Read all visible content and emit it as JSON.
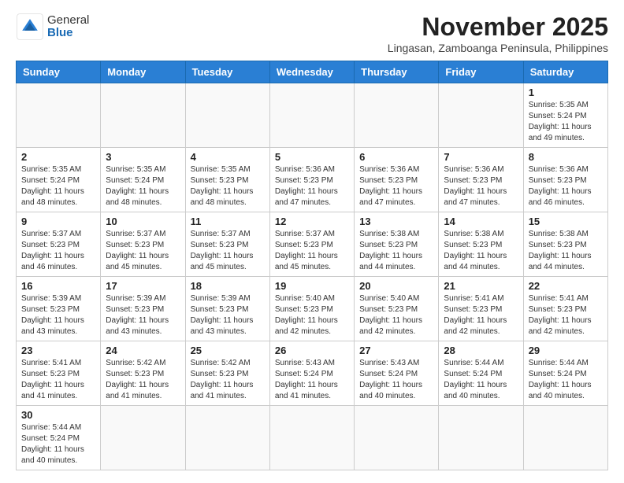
{
  "header": {
    "logo_general": "General",
    "logo_blue": "Blue",
    "month_title": "November 2025",
    "location": "Lingasan, Zamboanga Peninsula, Philippines"
  },
  "days_of_week": [
    "Sunday",
    "Monday",
    "Tuesday",
    "Wednesday",
    "Thursday",
    "Friday",
    "Saturday"
  ],
  "weeks": [
    [
      {
        "day": null
      },
      {
        "day": null
      },
      {
        "day": null
      },
      {
        "day": null
      },
      {
        "day": null
      },
      {
        "day": null
      },
      {
        "day": 1,
        "sunrise": "5:35 AM",
        "sunset": "5:24 PM",
        "daylight": "11 hours and 49 minutes."
      }
    ],
    [
      {
        "day": 2,
        "sunrise": "5:35 AM",
        "sunset": "5:24 PM",
        "daylight": "11 hours and 48 minutes."
      },
      {
        "day": 3,
        "sunrise": "5:35 AM",
        "sunset": "5:24 PM",
        "daylight": "11 hours and 48 minutes."
      },
      {
        "day": 4,
        "sunrise": "5:35 AM",
        "sunset": "5:23 PM",
        "daylight": "11 hours and 48 minutes."
      },
      {
        "day": 5,
        "sunrise": "5:36 AM",
        "sunset": "5:23 PM",
        "daylight": "11 hours and 47 minutes."
      },
      {
        "day": 6,
        "sunrise": "5:36 AM",
        "sunset": "5:23 PM",
        "daylight": "11 hours and 47 minutes."
      },
      {
        "day": 7,
        "sunrise": "5:36 AM",
        "sunset": "5:23 PM",
        "daylight": "11 hours and 47 minutes."
      },
      {
        "day": 8,
        "sunrise": "5:36 AM",
        "sunset": "5:23 PM",
        "daylight": "11 hours and 46 minutes."
      }
    ],
    [
      {
        "day": 9,
        "sunrise": "5:37 AM",
        "sunset": "5:23 PM",
        "daylight": "11 hours and 46 minutes."
      },
      {
        "day": 10,
        "sunrise": "5:37 AM",
        "sunset": "5:23 PM",
        "daylight": "11 hours and 45 minutes."
      },
      {
        "day": 11,
        "sunrise": "5:37 AM",
        "sunset": "5:23 PM",
        "daylight": "11 hours and 45 minutes."
      },
      {
        "day": 12,
        "sunrise": "5:37 AM",
        "sunset": "5:23 PM",
        "daylight": "11 hours and 45 minutes."
      },
      {
        "day": 13,
        "sunrise": "5:38 AM",
        "sunset": "5:23 PM",
        "daylight": "11 hours and 44 minutes."
      },
      {
        "day": 14,
        "sunrise": "5:38 AM",
        "sunset": "5:23 PM",
        "daylight": "11 hours and 44 minutes."
      },
      {
        "day": 15,
        "sunrise": "5:38 AM",
        "sunset": "5:23 PM",
        "daylight": "11 hours and 44 minutes."
      }
    ],
    [
      {
        "day": 16,
        "sunrise": "5:39 AM",
        "sunset": "5:23 PM",
        "daylight": "11 hours and 43 minutes."
      },
      {
        "day": 17,
        "sunrise": "5:39 AM",
        "sunset": "5:23 PM",
        "daylight": "11 hours and 43 minutes."
      },
      {
        "day": 18,
        "sunrise": "5:39 AM",
        "sunset": "5:23 PM",
        "daylight": "11 hours and 43 minutes."
      },
      {
        "day": 19,
        "sunrise": "5:40 AM",
        "sunset": "5:23 PM",
        "daylight": "11 hours and 42 minutes."
      },
      {
        "day": 20,
        "sunrise": "5:40 AM",
        "sunset": "5:23 PM",
        "daylight": "11 hours and 42 minutes."
      },
      {
        "day": 21,
        "sunrise": "5:41 AM",
        "sunset": "5:23 PM",
        "daylight": "11 hours and 42 minutes."
      },
      {
        "day": 22,
        "sunrise": "5:41 AM",
        "sunset": "5:23 PM",
        "daylight": "11 hours and 42 minutes."
      }
    ],
    [
      {
        "day": 23,
        "sunrise": "5:41 AM",
        "sunset": "5:23 PM",
        "daylight": "11 hours and 41 minutes."
      },
      {
        "day": 24,
        "sunrise": "5:42 AM",
        "sunset": "5:23 PM",
        "daylight": "11 hours and 41 minutes."
      },
      {
        "day": 25,
        "sunrise": "5:42 AM",
        "sunset": "5:23 PM",
        "daylight": "11 hours and 41 minutes."
      },
      {
        "day": 26,
        "sunrise": "5:43 AM",
        "sunset": "5:24 PM",
        "daylight": "11 hours and 41 minutes."
      },
      {
        "day": 27,
        "sunrise": "5:43 AM",
        "sunset": "5:24 PM",
        "daylight": "11 hours and 40 minutes."
      },
      {
        "day": 28,
        "sunrise": "5:44 AM",
        "sunset": "5:24 PM",
        "daylight": "11 hours and 40 minutes."
      },
      {
        "day": 29,
        "sunrise": "5:44 AM",
        "sunset": "5:24 PM",
        "daylight": "11 hours and 40 minutes."
      }
    ],
    [
      {
        "day": 30,
        "sunrise": "5:44 AM",
        "sunset": "5:24 PM",
        "daylight": "11 hours and 40 minutes."
      },
      {
        "day": null
      },
      {
        "day": null
      },
      {
        "day": null
      },
      {
        "day": null
      },
      {
        "day": null
      },
      {
        "day": null
      }
    ]
  ],
  "labels": {
    "sunrise": "Sunrise:",
    "sunset": "Sunset:",
    "daylight": "Daylight:"
  }
}
